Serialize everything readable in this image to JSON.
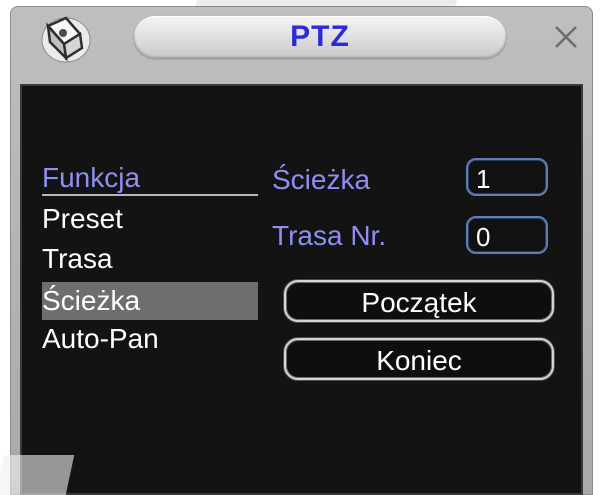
{
  "window": {
    "title": "PTZ"
  },
  "icons": {
    "app": "camera-icon",
    "close": "close-icon"
  },
  "menu": {
    "header": "Funkcja",
    "items": [
      {
        "label": "Preset",
        "selected": false
      },
      {
        "label": "Trasa",
        "selected": false
      },
      {
        "label": "Ścieżka",
        "selected": true
      },
      {
        "label": "Auto-Pan",
        "selected": false
      }
    ]
  },
  "fields": {
    "path_label": "Ścieżka",
    "path_value": "1",
    "route_label": "Trasa Nr.",
    "route_value": "0"
  },
  "buttons": {
    "start": "Początek",
    "end": "Koniec"
  },
  "colors": {
    "title_text": "#2b2bd8",
    "accent_label": "#8d8ff2",
    "content_bg": "#131313",
    "selected_bg": "#6e6e6e"
  }
}
